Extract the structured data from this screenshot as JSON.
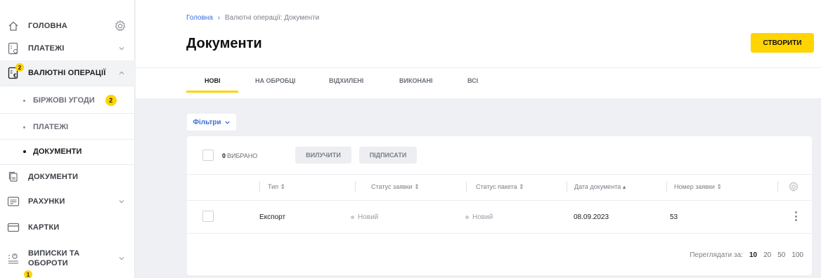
{
  "sidebar": {
    "items": [
      {
        "label": "ГОЛОВНА",
        "icon": "home-icon"
      },
      {
        "label": "ПЛАТЕЖІ",
        "icon": "payment-doc-icon"
      },
      {
        "label": "ВАЛЮТНІ ОПЕРАЦІЇ",
        "icon": "currency-doc-icon",
        "badge": "2"
      },
      {
        "label": "ДОКУМЕНТИ",
        "icon": "documents-icon"
      },
      {
        "label": "РАХУНКИ",
        "icon": "accounts-icon"
      },
      {
        "label": "КАРТКИ",
        "icon": "card-icon"
      },
      {
        "label": "ВИПИСКИ ТА ОБОРОТИ",
        "icon": "statements-icon"
      }
    ],
    "sub_items": [
      {
        "label": "БІРЖОВІ УГОДИ",
        "badge": "2"
      },
      {
        "label": "ПЛАТЕЖІ"
      },
      {
        "label": "ДОКУМЕНТИ"
      }
    ],
    "bottom_badge": "1"
  },
  "breadcrumb": {
    "home": "Головна",
    "separator": "›",
    "current": "Валютні операції: Документи"
  },
  "page_title": "Документи",
  "create_button": "СТВОРИТИ",
  "tabs": [
    {
      "label": "НОВІ",
      "active": true
    },
    {
      "label": "НА ОБРОБЦІ"
    },
    {
      "label": "ВІДХИЛЕНІ"
    },
    {
      "label": "ВИКОНАНІ"
    },
    {
      "label": "ВСІ"
    }
  ],
  "filters_label": "Фільтри",
  "toolbar": {
    "selected_count": "0",
    "selected_label": "ВИБРАНО",
    "remove_label": "ВИЛУЧИТИ",
    "sign_label": "ПІДПИСАТИ"
  },
  "table": {
    "columns": [
      "Тип ⇕",
      "Статус заявки ⇕",
      "Статус пакета ⇕",
      "Дата документа ▴",
      "Номер заявки ⇕"
    ],
    "rows": [
      {
        "type": "Експорт",
        "request_status": "Новий",
        "package_status": "Новий",
        "date": "08.09.2023",
        "number": "53"
      }
    ]
  },
  "pager": {
    "label": "Переглядати за:",
    "sizes": [
      "10",
      "20",
      "50",
      "100"
    ],
    "selected": "10"
  },
  "colors": {
    "accent": "#ffd400",
    "link": "#3a6fd8"
  }
}
